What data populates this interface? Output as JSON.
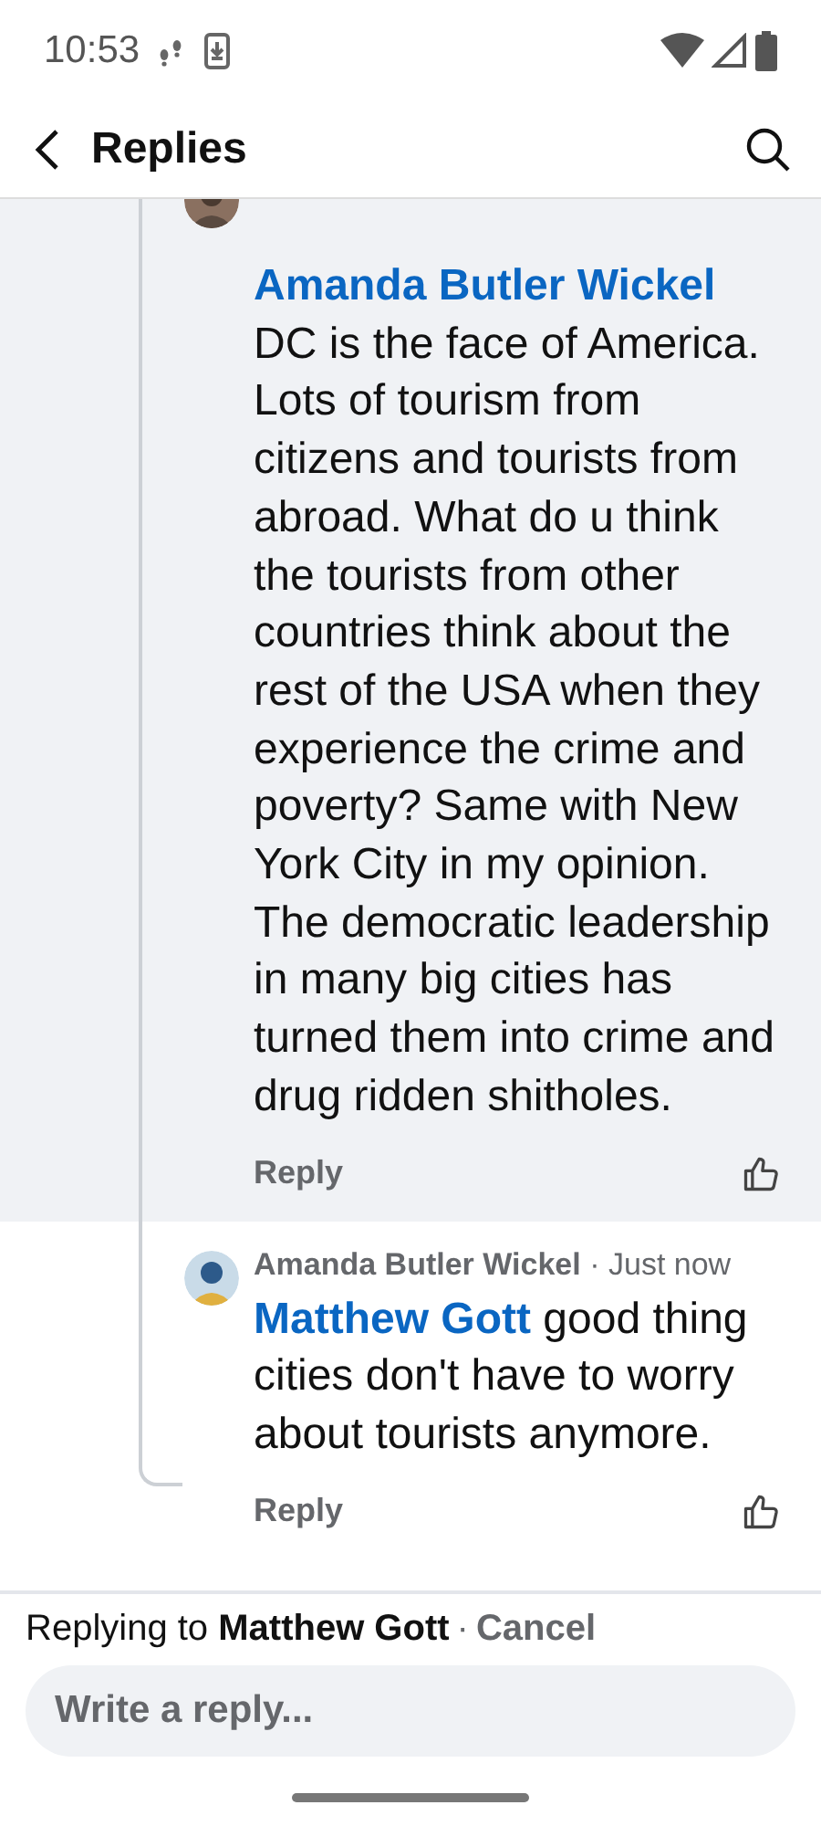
{
  "status_bar": {
    "time": "10:53"
  },
  "header": {
    "title": "Replies"
  },
  "comments": [
    {
      "kind": "clipped",
      "mention": "Amanda Butler Wickel",
      "text": "DC is the face of America. Lots of tourism from citizens and tourists from abroad. What do u think the tourists from other countries think about the rest of the USA when they experience the crime and poverty? Same with New York City in my opinion. The democratic leadership in many big cities has turned them into crime and drug ridden shitholes.",
      "reply_label": "Reply",
      "highlighted": true
    },
    {
      "kind": "full",
      "author": "Amanda Butler Wickel",
      "separator": "·",
      "time": "Just now",
      "mention": "Matthew Gott",
      "text": "good thing cities don't have to worry about tourists anymore.",
      "reply_label": "Reply",
      "highlighted": false
    }
  ],
  "composer": {
    "replying_to": "Replying to **Matthew Gott**",
    "separator": "·",
    "cancel": "Cancel",
    "placeholder": "Write a reply..."
  }
}
